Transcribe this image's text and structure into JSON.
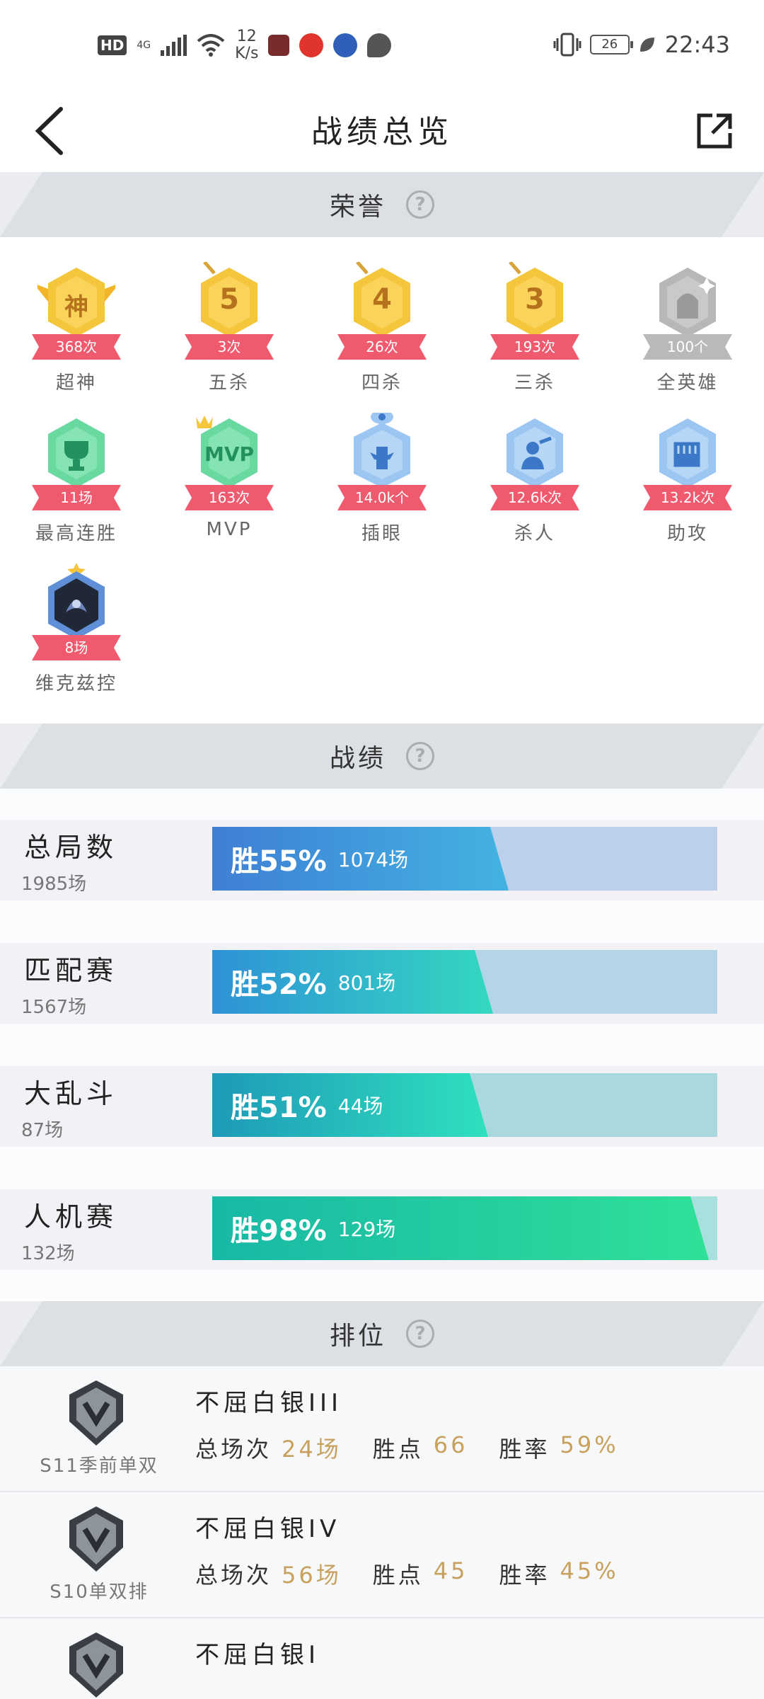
{
  "status_bar": {
    "hd": "HD",
    "net": "4G",
    "speed_value": "12",
    "speed_unit": "K/s",
    "battery": "26",
    "time": "22:43"
  },
  "header": {
    "title": "战绩总览"
  },
  "honors": {
    "title": "荣誉",
    "help": "?",
    "badges": [
      {
        "label": "超神",
        "value": "368次",
        "glyph": "神"
      },
      {
        "label": "五杀",
        "value": "3次",
        "glyph": "5"
      },
      {
        "label": "四杀",
        "value": "26次",
        "glyph": "4"
      },
      {
        "label": "三杀",
        "value": "193次",
        "glyph": "3"
      },
      {
        "label": "全英雄",
        "value": "100个"
      },
      {
        "label": "最高连胜",
        "value": "11场"
      },
      {
        "label": "MVP",
        "value": "163次",
        "glyph": "MVP"
      },
      {
        "label": "插眼",
        "value": "14.0k个"
      },
      {
        "label": "杀人",
        "value": "12.6k次"
      },
      {
        "label": "助攻",
        "value": "13.2k次"
      },
      {
        "label": "维克兹控",
        "value": "8场"
      }
    ]
  },
  "record": {
    "title": "战绩",
    "help": "?",
    "rows": [
      {
        "name": "总局数",
        "count": "1985场",
        "win_label": "胜55%",
        "win_games": "1074场",
        "win_rate": 0.55
      },
      {
        "name": "匹配赛",
        "count": "1567场",
        "win_label": "胜52%",
        "win_games": "801场",
        "win_rate": 0.52
      },
      {
        "name": "大乱斗",
        "count": "87场",
        "win_label": "胜51%",
        "win_games": "44场",
        "win_rate": 0.51
      },
      {
        "name": "人机赛",
        "count": "132场",
        "win_label": "胜98%",
        "win_games": "129场",
        "win_rate": 0.98
      }
    ]
  },
  "ranked": {
    "title": "排位",
    "help": "?",
    "stat_labels": {
      "games": "总场次",
      "points": "胜点",
      "rate": "胜率"
    },
    "rows": [
      {
        "season": "S11季前单双",
        "tier": "不屈白银III",
        "games": "24场",
        "points": "66",
        "rate": "59%"
      },
      {
        "season": "S10单双排",
        "tier": "不屈白银IV",
        "games": "56场",
        "points": "45",
        "rate": "45%"
      },
      {
        "season": "",
        "tier": "不屈白银I",
        "games": "",
        "points": "",
        "rate": ""
      }
    ]
  },
  "colors": {
    "accent_pink": "#f05a6e",
    "gold": "#f5c63c",
    "value_gold": "#c9a15e"
  }
}
